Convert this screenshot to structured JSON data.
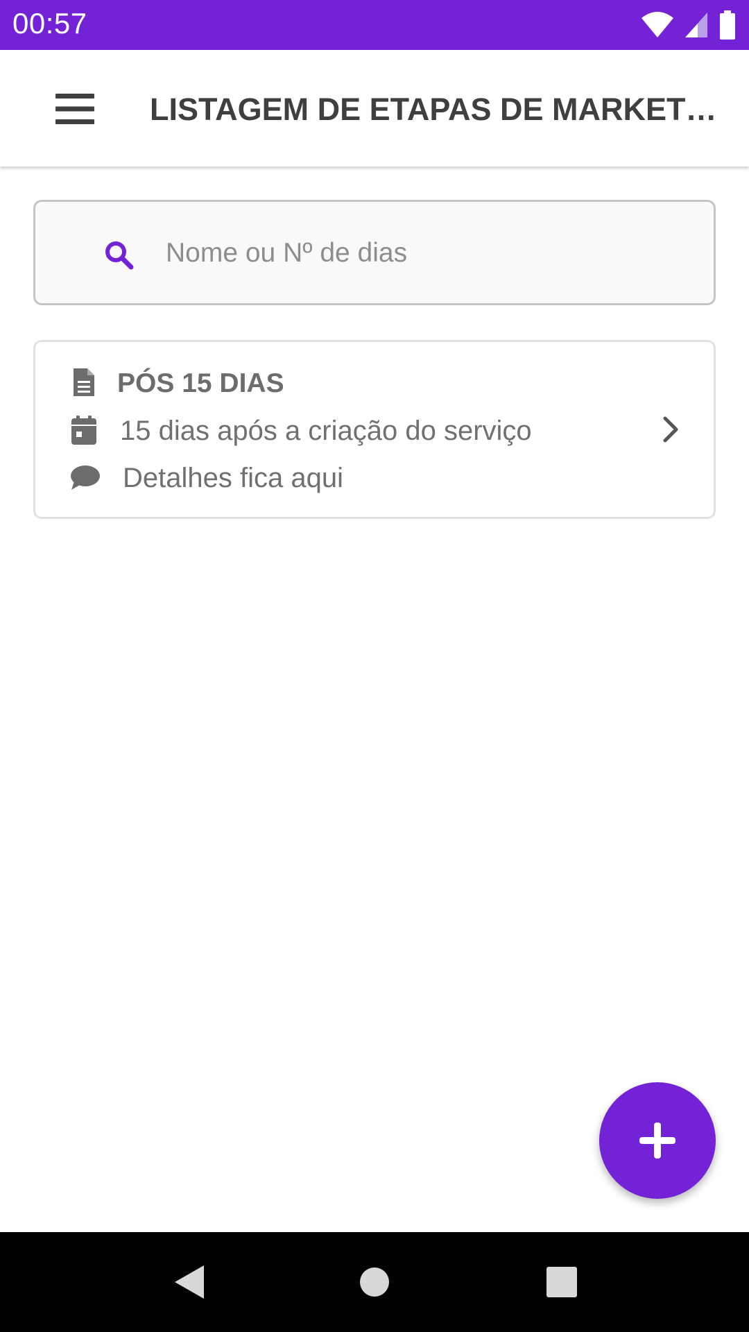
{
  "status_bar": {
    "time": "00:57",
    "icons": [
      "wifi-icon",
      "signal-icon",
      "battery-icon"
    ],
    "background_color": "#7322D6"
  },
  "app_bar": {
    "menu_icon": "hamburger-menu-icon",
    "title": "LISTAGEM DE ETAPAS DE MARKETI…"
  },
  "search": {
    "icon": "search-icon",
    "placeholder": "Nome ou Nº de dias",
    "value": ""
  },
  "stages": [
    {
      "title": "PÓS 15 DIAS",
      "title_icon": "document-icon",
      "schedule": "15 dias após a criação do serviço",
      "schedule_icon": "calendar-icon",
      "details": "Detalhes fica aqui",
      "details_icon": "comment-icon",
      "action_icon": "chevron-right-icon"
    }
  ],
  "fab": {
    "icon": "plus-icon",
    "color": "#7322D6"
  },
  "nav_bar": {
    "buttons": [
      "back-icon",
      "home-icon",
      "recents-icon"
    ]
  },
  "colors": {
    "accent": "#7322D6",
    "text_primary": "#3f3f3f",
    "text_secondary": "#707070"
  }
}
